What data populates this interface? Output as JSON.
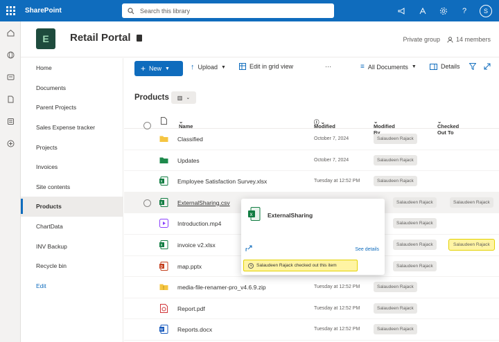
{
  "suite": {
    "brand": "SharePoint",
    "search_placeholder": "Search this library",
    "avatar_initial": "S"
  },
  "site": {
    "title": "Retail Portal",
    "privacy": "Private group",
    "members": "14 members",
    "logo_glyph": "E"
  },
  "nav": {
    "items": [
      {
        "label": "Home"
      },
      {
        "label": "Documents"
      },
      {
        "label": "Parent Projects"
      },
      {
        "label": "Sales Expense tracker"
      },
      {
        "label": "Projects"
      },
      {
        "label": "Invoices"
      },
      {
        "label": "Site contents"
      },
      {
        "label": "Products"
      },
      {
        "label": "ChartData"
      },
      {
        "label": "INV Backup"
      },
      {
        "label": "Recycle bin"
      },
      {
        "label": "Edit"
      }
    ],
    "active_index": 7
  },
  "commands": {
    "new": "New",
    "upload": "Upload",
    "grid": "Edit in grid view",
    "more": "···",
    "view": "All Documents",
    "details": "Details"
  },
  "library": {
    "title": "Products",
    "columns": {
      "name": "Name",
      "modified": "Modified",
      "modified_by": "Modified By",
      "checked_out": "Checked Out To"
    },
    "rows": [
      {
        "name": "Classified",
        "modified": "October 7, 2024",
        "by": "Salaudeen Rajack",
        "checked": "",
        "icon": "folder-icon"
      },
      {
        "name": "Updates",
        "modified": "October 7, 2024",
        "by": "Salaudeen Rajack",
        "checked": "",
        "icon": "folder-icon"
      },
      {
        "name": "Employee Satisfaction Survey.xlsx",
        "modified": "Tuesday at 12:52 PM",
        "by": "Salaudeen Rajack",
        "checked": "",
        "icon": "excel-icon"
      },
      {
        "name": "ExternalSharing.csv",
        "modified": "",
        "by": "Salaudeen Rajack",
        "checked": "Salaudeen Rajack",
        "icon": "excel-icon"
      },
      {
        "name": "Introduction.mp4",
        "modified": "",
        "by": "Salaudeen Rajack",
        "checked": "",
        "icon": "video-icon"
      },
      {
        "name": "invoice v2.xlsx",
        "modified": "",
        "by": "Salaudeen Rajack",
        "checked": "Salaudeen Rajack",
        "icon": "excel-icon"
      },
      {
        "name": "map.pptx",
        "modified": "",
        "by": "Salaudeen Rajack",
        "checked": "",
        "icon": "powerpoint-icon"
      },
      {
        "name": "media-file-renamer-pro_v4.6.9.zip",
        "modified": "Tuesday at 12:52 PM",
        "by": "Salaudeen Rajack",
        "checked": "",
        "icon": "zip-icon"
      },
      {
        "name": "Report.pdf",
        "modified": "Tuesday at 12:52 PM",
        "by": "Salaudeen Rajack",
        "checked": "",
        "icon": "pdf-icon"
      },
      {
        "name": "Reports.docx",
        "modified": "Tuesday at 12:52 PM",
        "by": "Salaudeen Rajack",
        "checked": "",
        "icon": "word-icon"
      }
    ]
  },
  "popup": {
    "title": "ExternalSharing",
    "see_details": "See details",
    "notice": "Salaudeen Rajack checked out this item"
  },
  "colors": {
    "accent": "#0f6cbd",
    "highlight": "#fff4a3",
    "excel": "#107c41",
    "folder": "#f5c542",
    "pdf": "#d13438",
    "word": "#185abd",
    "ppt": "#c43e1c",
    "video": "#8a3ffc"
  }
}
